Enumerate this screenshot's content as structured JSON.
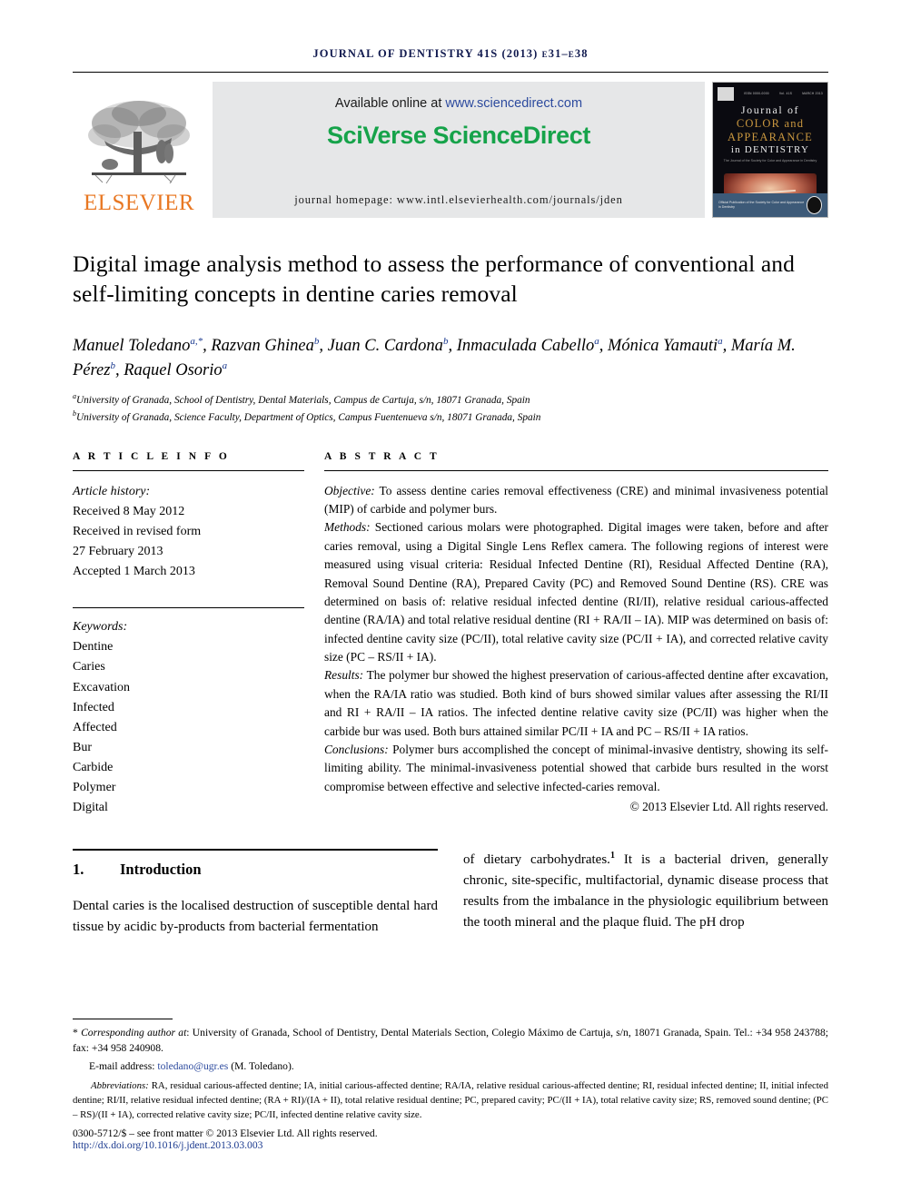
{
  "running_head": "JOURNAL OF DENTISTRY 41S (2013) e31–e38",
  "header": {
    "available_prefix": "Available online at ",
    "available_url": "www.sciencedirect.com",
    "brand": "SciVerse ScienceDirect",
    "homepage": "journal homepage: www.intl.elsevierhealth.com/journals/jden",
    "publisher_name": "ELSEVIER",
    "cover": {
      "line1": "Journal of",
      "line2": "COLOR and",
      "line3": "APPEARANCE",
      "line4": "in DENTISTRY",
      "subtitle": "The Journal of the Society for Color and Appearance in Dentistry",
      "top_left_label": "ISSN 0000-0000",
      "top_mid_label": "Vol. 41S",
      "top_right_label": "MARCH 2013",
      "footer_text": "Official Publication of the Society for Color and Appearance in Dentistry"
    }
  },
  "article": {
    "title": "Digital image analysis method to assess the performance of conventional and self-limiting concepts in dentine caries removal",
    "authors_line1": "Manuel Toledano",
    "authors": [
      {
        "name": "Manuel Toledano",
        "marks": "a,*"
      },
      {
        "name": "Razvan Ghinea",
        "marks": "b"
      },
      {
        "name": "Juan C. Cardona",
        "marks": "b"
      },
      {
        "name": "Inmaculada Cabello",
        "marks": "a"
      },
      {
        "name": "Mónica Yamauti",
        "marks": "a"
      },
      {
        "name": "María M. Pérez",
        "marks": "b"
      },
      {
        "name": "Raquel Osorio",
        "marks": "a"
      }
    ],
    "affiliations": [
      {
        "mark": "a",
        "text": "University of Granada, School of Dentistry, Dental Materials, Campus de Cartuja, s/n, 18071 Granada, Spain"
      },
      {
        "mark": "b",
        "text": "University of Granada, Science Faculty, Department of Optics, Campus Fuentenueva s/n, 18071 Granada, Spain"
      }
    ]
  },
  "article_info": {
    "heading": "A R T I C L E   I N F O",
    "history_label": "Article history:",
    "history": [
      "Received 8 May 2012",
      "Received in revised form",
      "27 February 2013",
      "Accepted 1 March 2013"
    ],
    "keywords_label": "Keywords:",
    "keywords": [
      "Dentine",
      "Caries",
      "Excavation",
      "Infected",
      "Affected",
      "Bur",
      "Carbide",
      "Polymer",
      "Digital"
    ]
  },
  "abstract": {
    "heading": "A B S T R A C T",
    "sections": [
      {
        "label": "Objective:",
        "text": " To assess dentine caries removal effectiveness (CRE) and minimal invasiveness potential (MIP) of carbide and polymer burs."
      },
      {
        "label": "Methods:",
        "text": " Sectioned carious molars were photographed. Digital images were taken, before and after caries removal, using a Digital Single Lens Reflex camera. The following regions of interest were measured using visual criteria: Residual Infected Dentine (RI), Residual Affected Dentine (RA), Removal Sound Dentine (RA), Prepared Cavity (PC) and Removed Sound Dentine (RS). CRE was determined on basis of: relative residual infected dentine (RI/II), relative residual carious-affected dentine (RA/IA) and total relative residual dentine (RI + RA/II – IA). MIP was determined on basis of: infected dentine cavity size (PC/II), total relative cavity size (PC/II + IA), and corrected relative cavity size (PC – RS/II + IA)."
      },
      {
        "label": "Results:",
        "text": " The polymer bur showed the highest preservation of carious-affected dentine after excavation, when the RA/IA ratio was studied. Both kind of burs showed similar values after assessing the RI/II and RI + RA/II – IA ratios. The infected dentine relative cavity size (PC/II) was higher when the carbide bur was used. Both burs attained similar PC/II + IA and PC – RS/II + IA ratios."
      },
      {
        "label": "Conclusions:",
        "text": " Polymer burs accomplished the concept of minimal-invasive dentistry, showing its self-limiting ability. The minimal-invasiveness potential showed that carbide burs resulted in the worst compromise between effective and selective infected-caries removal."
      }
    ],
    "copyright": "© 2013 Elsevier Ltd. All rights reserved."
  },
  "introduction": {
    "number": "1.",
    "heading": "Introduction",
    "left_paragraph": "Dental caries is the localised destruction of susceptible dental hard tissue by acidic by-products from bacterial fermentation",
    "right_paragraph_pre": "of dietary carbohydrates.",
    "right_paragraph_ref": "1",
    "right_paragraph_post": " It is a bacterial driven, generally chronic, site-specific, multifactorial, dynamic disease process that results from the imbalance in the physiologic equilibrium between the tooth mineral and the plaque fluid. The pH drop"
  },
  "footnotes": {
    "corresponding_label": "Corresponding author at",
    "corresponding_text": ": University of Granada, School of Dentistry, Dental Materials Section, Colegio Máximo de Cartuja, s/n, 18071 Granada, Spain. Tel.: +34 958 243788; fax: +34 958 240908.",
    "email_label": "E-mail address: ",
    "email": "toledano@ugr.es",
    "email_suffix": " (M. Toledano).",
    "abbrev_label": "Abbreviations:",
    "abbrev_text": " RA, residual carious-affected dentine; IA, initial carious-affected dentine; RA/IA, relative residual carious-affected dentine; RI, residual infected dentine; II, initial infected dentine; RI/II, relative residual infected dentine; (RA + RI)/(IA + II), total relative residual dentine; PC, prepared cavity; PC/(II + IA), total relative cavity size; RS, removed sound dentine; (PC – RS)/(II + IA), corrected relative cavity size; PC/II, infected dentine relative cavity size.",
    "issn_line": "0300-5712/$ – see front matter © 2013 Elsevier Ltd. All rights reserved.",
    "doi_line": "http://dx.doi.org/10.1016/j.jdent.2013.03.003"
  },
  "colors": {
    "brand_green": "#16a34a",
    "elsevier_orange": "#e87722",
    "link_blue": "#2c4a9e",
    "running_head_navy": "#111a4f"
  }
}
